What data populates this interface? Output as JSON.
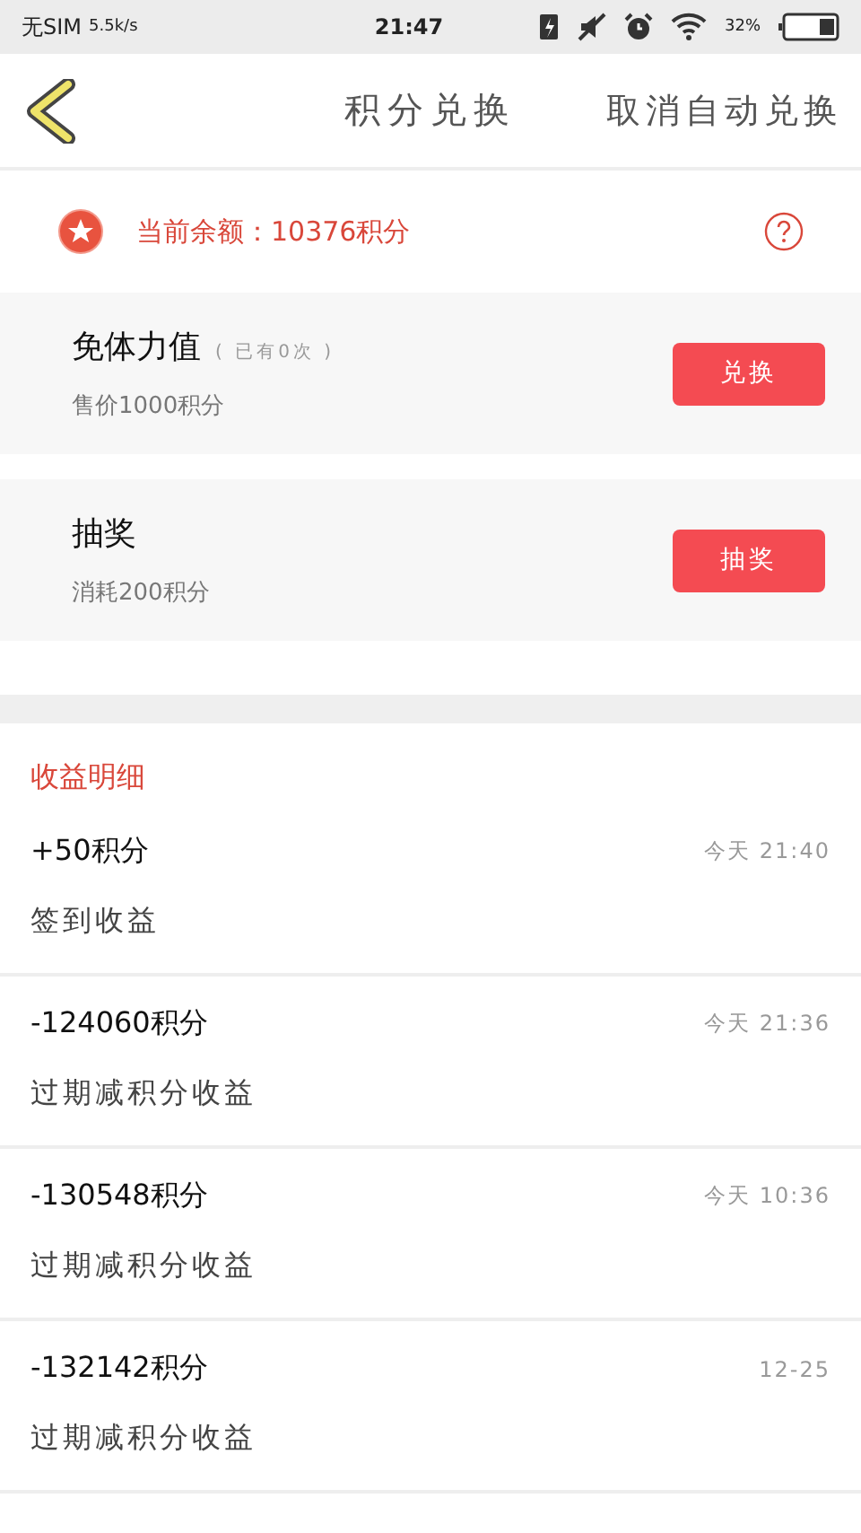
{
  "status_bar": {
    "carrier": "无SIM",
    "speed": "5.5k/s",
    "time": "21:47",
    "battery": "32%"
  },
  "header": {
    "title": "积分兑换",
    "action": "取消自动兑换"
  },
  "balance": {
    "label": "当前余额：10376积分"
  },
  "offers": [
    {
      "title": "免体力值",
      "note": "( 已有0次 )",
      "subtitle": "售价1000积分",
      "button": "兑换"
    },
    {
      "title": "抽奖",
      "subtitle": "消耗200积分",
      "button": "抽奖"
    }
  ],
  "records_title": "收益明细",
  "records": [
    {
      "amount": "+50积分",
      "description": "签到收益",
      "time": "今天 21:40"
    },
    {
      "amount": "-124060积分",
      "description": "过期减积分收益",
      "time": "今天 21:36"
    },
    {
      "amount": "-130548积分",
      "description": "过期减积分收益",
      "time": "今天 10:36"
    },
    {
      "amount": "-132142积分",
      "description": "过期减积分收益",
      "time": "12-25"
    }
  ]
}
